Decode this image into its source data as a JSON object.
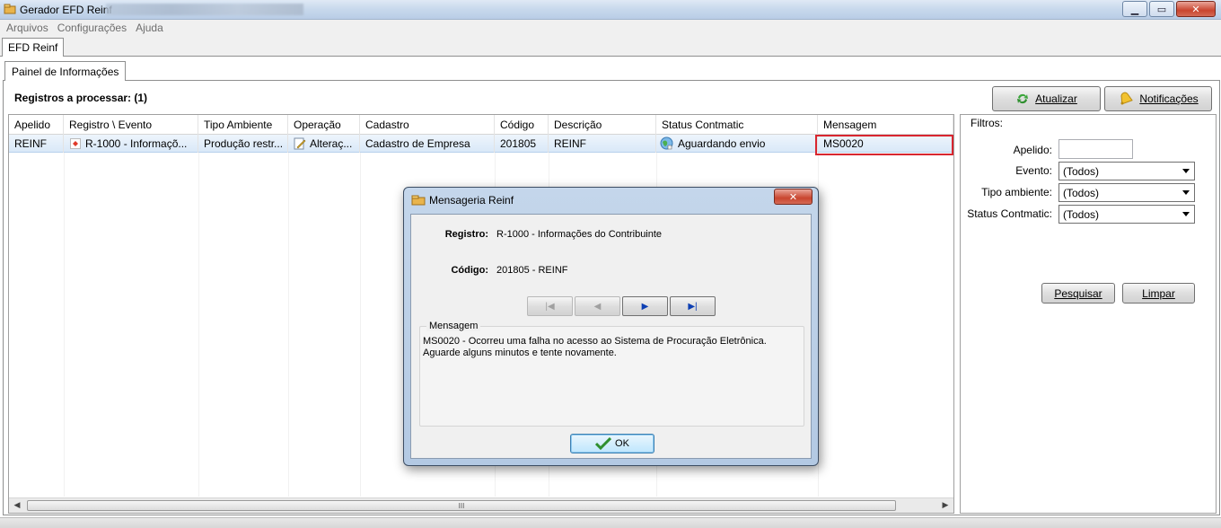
{
  "window": {
    "title": "Gerador EFD Reinf",
    "minimize_label": "▁",
    "maximize_label": "▭",
    "close_label": "✕"
  },
  "menu": [
    "Arquivos",
    "Configurações",
    "Ajuda"
  ],
  "outer_tab": "EFD Reinf",
  "inner_tab": "Painel de Informações",
  "records_label": "Registros a processar: (1)",
  "toolbar": {
    "refresh_label": "Atualizar",
    "notifications_label": "Notificações"
  },
  "grid": {
    "columns": [
      "Apelido",
      "Registro \\ Evento",
      "Tipo Ambiente",
      "Operação",
      "Cadastro",
      "Código",
      "Descrição",
      "Status Contmatic",
      "Mensagem"
    ],
    "rows": [
      {
        "apelido": "REINF",
        "registro": "R-1000 - Informaçõ...",
        "tipo_ambiente": "Produção restr...",
        "operacao": "Alteraç...",
        "cadastro": "Cadastro de Empresa",
        "codigo": "201805",
        "descricao": "REINF",
        "status": "Aguardando envio",
        "mensagem": "MS0020"
      }
    ],
    "scroll_grip": "III"
  },
  "filters": {
    "legend": "Filtros:",
    "apelido_label": "Apelido:",
    "apelido_value": "",
    "evento_label": "Evento:",
    "evento_value": "(Todos)",
    "tipo_label": "Tipo ambiente:",
    "tipo_value": "(Todos)",
    "status_label": "Status Contmatic:",
    "status_value": "(Todos)",
    "search_label": "Pesquisar",
    "clear_label": "Limpar"
  },
  "dialog": {
    "title": "Mensageria Reinf",
    "registro_label": "Registro:",
    "registro_value": "R-1000 - Informações do Contribuinte",
    "codigo_label": "Código:",
    "codigo_value": "201805 - REINF",
    "message_legend": "Mensagem",
    "message_text": "MS0020 - Ocorreu uma falha no acesso ao Sistema de Procuração Eletrônica. Aguarde alguns minutos e tente novamente.",
    "ok_label": "OK"
  },
  "colors": {
    "highlight_border": "#d8262f",
    "selected_row": "#d9e8f8",
    "dialog_frame": "#b3c9e3"
  }
}
